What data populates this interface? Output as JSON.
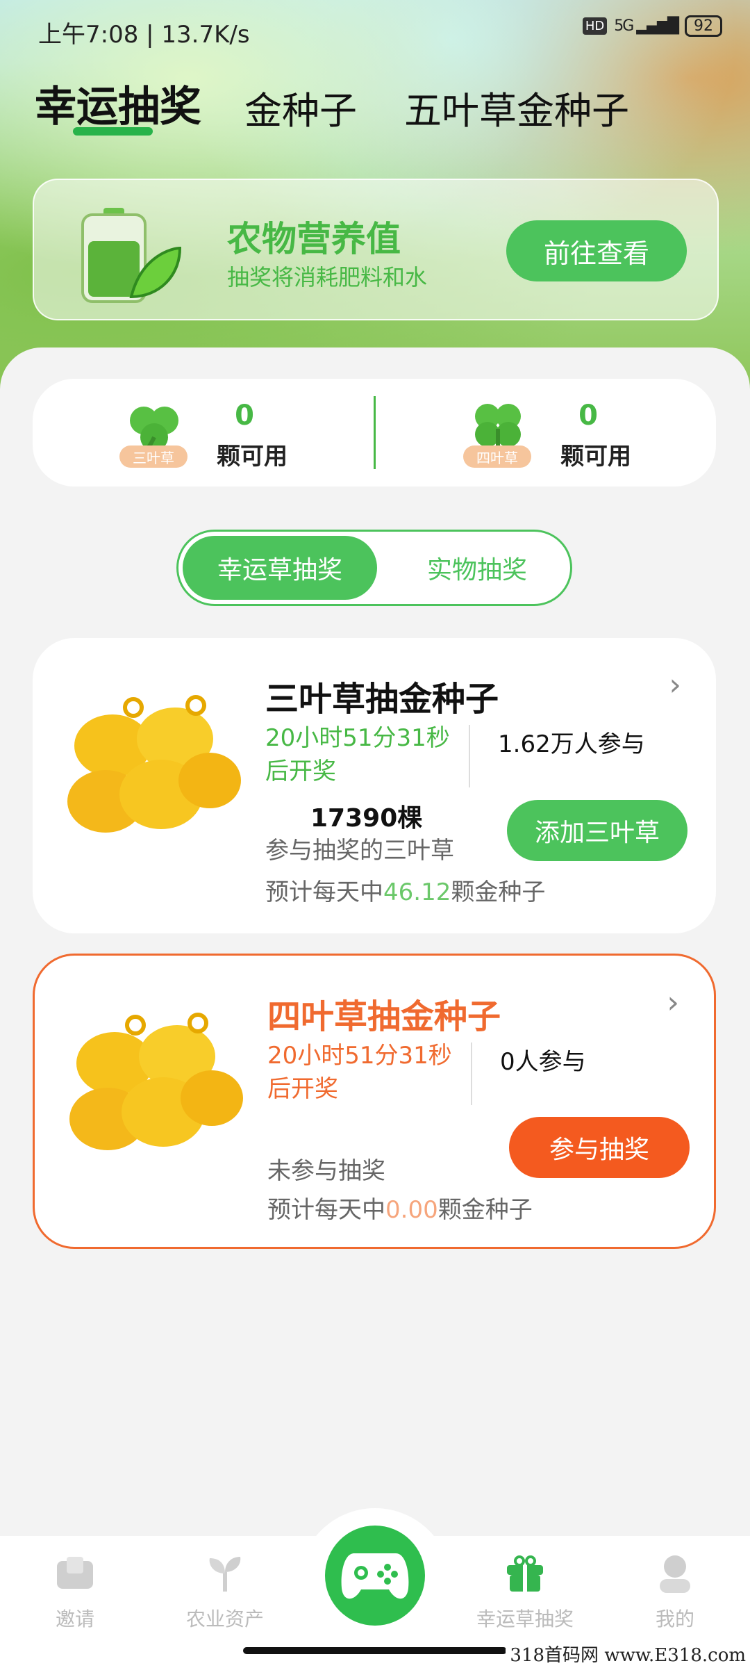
{
  "status_bar": {
    "time": "上午7:08 | 13.7K/s",
    "network_badge": "HD",
    "signal": "5G",
    "battery": "92"
  },
  "top_tabs": [
    {
      "label": "幸运抽奖",
      "active": true
    },
    {
      "label": "金种子",
      "active": false
    },
    {
      "label": "五叶草金种子",
      "active": false
    }
  ],
  "banner": {
    "title": "农物营养值",
    "subtitle": "抽奖将消耗肥料和水",
    "button": "前往查看"
  },
  "counts": [
    {
      "tag": "三叶草",
      "value": "0",
      "label": "颗可用",
      "icon": "three-leaf-clover-icon"
    },
    {
      "tag": "四叶草",
      "value": "0",
      "label": "颗可用",
      "icon": "four-leaf-clover-icon"
    }
  ],
  "segment": {
    "option_a": "幸运草抽奖",
    "option_b": "实物抽奖",
    "selected": "幸运草抽奖"
  },
  "lotteries": [
    {
      "title": "三叶草抽金种子",
      "timer": "20小时51分31秒后开奖",
      "participants": "1.62万人参与",
      "amount": "17390棵",
      "amount_label": "参与抽奖的三叶草",
      "estimate_prefix": "预计每天中",
      "estimate_value": "46.12",
      "estimate_suffix": "颗金种子",
      "button": "添加三叶草",
      "accent": "#4cc35c"
    },
    {
      "title": "四叶草抽金种子",
      "timer": "20小时51分31秒后开奖",
      "participants": "0人参与",
      "amount": "",
      "amount_label": "未参与抽奖",
      "estimate_prefix": "预计每天中",
      "estimate_value": "0.00",
      "estimate_suffix": "颗金种子",
      "button": "参与抽奖",
      "accent": "#f06a2f"
    }
  ],
  "nav": [
    {
      "label": "邀请",
      "icon": "invite-icon",
      "active": false
    },
    {
      "label": "农业资产",
      "icon": "plant-icon",
      "active": false
    },
    {
      "label": "",
      "icon": "gamepad-icon",
      "active": false
    },
    {
      "label": "幸运草抽奖",
      "icon": "gift-icon",
      "active": true
    },
    {
      "label": "我的",
      "icon": "profile-icon",
      "active": false
    }
  ],
  "watermark": "318首码网 www.E318.com"
}
